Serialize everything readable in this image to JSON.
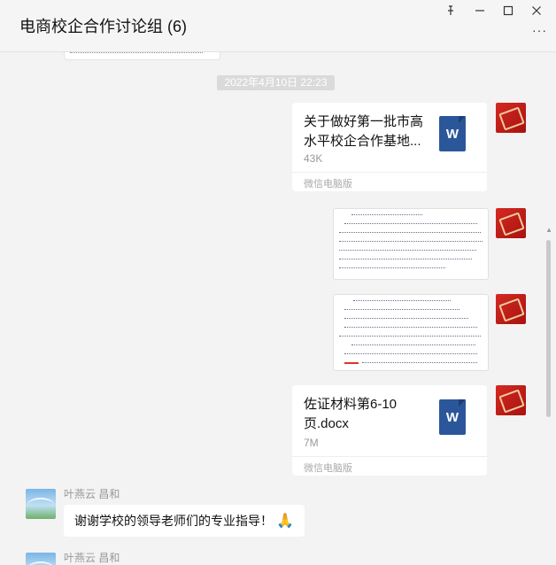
{
  "window": {
    "title": "电商校企合作讨论组 (6)",
    "controls": [
      "pin-icon",
      "minimize-icon",
      "maximize-icon",
      "close-icon"
    ],
    "more_label": "···"
  },
  "messages": {
    "timestamp": "2022年4月10日 22:23",
    "file1": {
      "name": "关于做好第一批市高水平校企合作基地...",
      "size": "43K",
      "source": "微信电脑版",
      "icon_letter": "W"
    },
    "file2": {
      "name": "佐证材料第6-10页.docx",
      "size": "7M",
      "source": "微信电脑版",
      "icon_letter": "W"
    },
    "reply1": {
      "sender": "叶燕云 昌和",
      "text": "谢谢学校的领导老师们的专业指导！",
      "emoji": "🙏"
    },
    "reply2": {
      "sender": "叶燕云 昌和"
    }
  },
  "colors": {
    "word_blue": "#2b579a",
    "avatar_red": "#d52a22"
  }
}
